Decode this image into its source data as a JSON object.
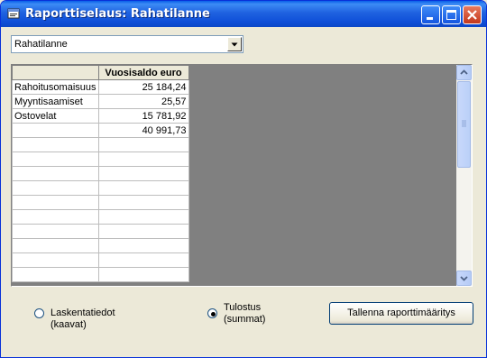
{
  "window": {
    "title": "Raporttiselaus: Rahatilanne"
  },
  "report_select": {
    "value": "Rahatilanne"
  },
  "grid": {
    "header": [
      "",
      "Vuosisaldo euro"
    ],
    "rows": [
      [
        "Rahoitusomaisuus",
        "25 184,24"
      ],
      [
        "Myyntisaamiset",
        "25,57"
      ],
      [
        "Ostovelat",
        "15 781,92"
      ],
      [
        "",
        "40 991,73"
      ],
      [
        "",
        ""
      ],
      [
        "",
        ""
      ],
      [
        "",
        ""
      ],
      [
        "",
        ""
      ],
      [
        "",
        ""
      ],
      [
        "",
        ""
      ],
      [
        "",
        ""
      ],
      [
        "",
        ""
      ],
      [
        "",
        ""
      ],
      [
        "",
        ""
      ]
    ]
  },
  "options": {
    "calc_label": "Laskentatiedot (kaavat)",
    "print_label_line1": "Tulostus",
    "print_label_line2": "(summat)",
    "selected": "print"
  },
  "buttons": {
    "save_label": "Tallenna raporttimääritys"
  }
}
